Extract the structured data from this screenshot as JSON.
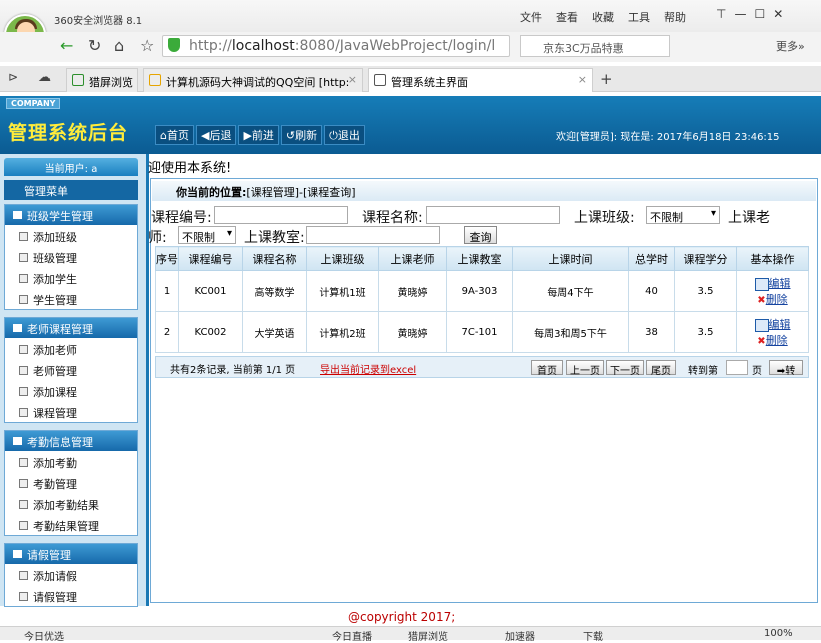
{
  "browser": {
    "title": "360安全浏览器 8.1",
    "menu": [
      "文件",
      "查看",
      "收藏",
      "工具",
      "帮助"
    ],
    "url_scheme": "http://",
    "url_host": "localhost",
    "url_rest": ":8080/JavaWebProject/login/l",
    "search_text": "京东3C万品特惠",
    "more": "更多»"
  },
  "tabs": [
    {
      "label": "猎屏浏览"
    },
    {
      "label": "计算机源码大神调试的QQ空间 [http:"
    },
    {
      "label": "管理系统主界面"
    }
  ],
  "header": {
    "company": "COMPANY",
    "title": "管理系统后台",
    "nav": [
      "首页",
      "后退",
      "前进",
      "刷新",
      "退出"
    ],
    "welcome": "欢迎[管理员]:  现在是: 2017年6月18日 23:46:15"
  },
  "sidebar": {
    "current_user": "当前用户: a",
    "menu_title": "管理菜单",
    "groups": [
      {
        "title": "班级学生管理",
        "items": [
          "添加班级",
          "班级管理",
          "添加学生",
          "学生管理"
        ]
      },
      {
        "title": "老师课程管理",
        "items": [
          "添加老师",
          "老师管理",
          "添加课程",
          "课程管理"
        ]
      },
      {
        "title": "考勤信息管理",
        "items": [
          "添加考勤",
          "考勤管理",
          "添加考勤结果",
          "考勤结果管理"
        ]
      },
      {
        "title": "请假管理",
        "items": [
          "添加请假",
          "请假管理"
        ]
      }
    ]
  },
  "main": {
    "marquee": "迎使用本系统!",
    "location_label": "你当前的位置:",
    "location_path": "[课程管理]-[课程查询]",
    "filters": {
      "course_no_label": "课程编号:",
      "course_name_label": "课程名称:",
      "class_label": "上课班级:",
      "class_value": "不限制",
      "teacher_label_1": "上课老",
      "teacher_label_2": "师:",
      "teacher_value": "不限制",
      "room_label": "上课教室:",
      "query_button": "查询"
    },
    "table": {
      "headers": [
        "序号",
        "课程编号",
        "课程名称",
        "上课班级",
        "上课老师",
        "上课教室",
        "上课时间",
        "总学时",
        "课程学分",
        "基本操作"
      ],
      "rows": [
        [
          "1",
          "KC001",
          "高等数学",
          "计算机1班",
          "黄晓婷",
          "9A-303",
          "每周4下午",
          "40",
          "3.5"
        ],
        [
          "2",
          "KC002",
          "大学英语",
          "计算机2班",
          "黄晓婷",
          "7C-101",
          "每周3和周5下午",
          "38",
          "3.5"
        ]
      ],
      "edit": "编辑",
      "delete": "删除"
    },
    "pager": {
      "info": "共有2条记录, 当前第 1/1 页",
      "export": "导出当前记录到excel",
      "first": "首页",
      "prev": "上一页",
      "next": "下一页",
      "last": "尾页",
      "goto": "转到第",
      "page": "页",
      "go": "转"
    }
  },
  "footer": "@copyright 2017;",
  "status": {
    "left": "今日优选",
    "items": [
      "今日直播",
      "猎屏浏览",
      "加速器",
      "下载"
    ],
    "zoom": "100%"
  }
}
